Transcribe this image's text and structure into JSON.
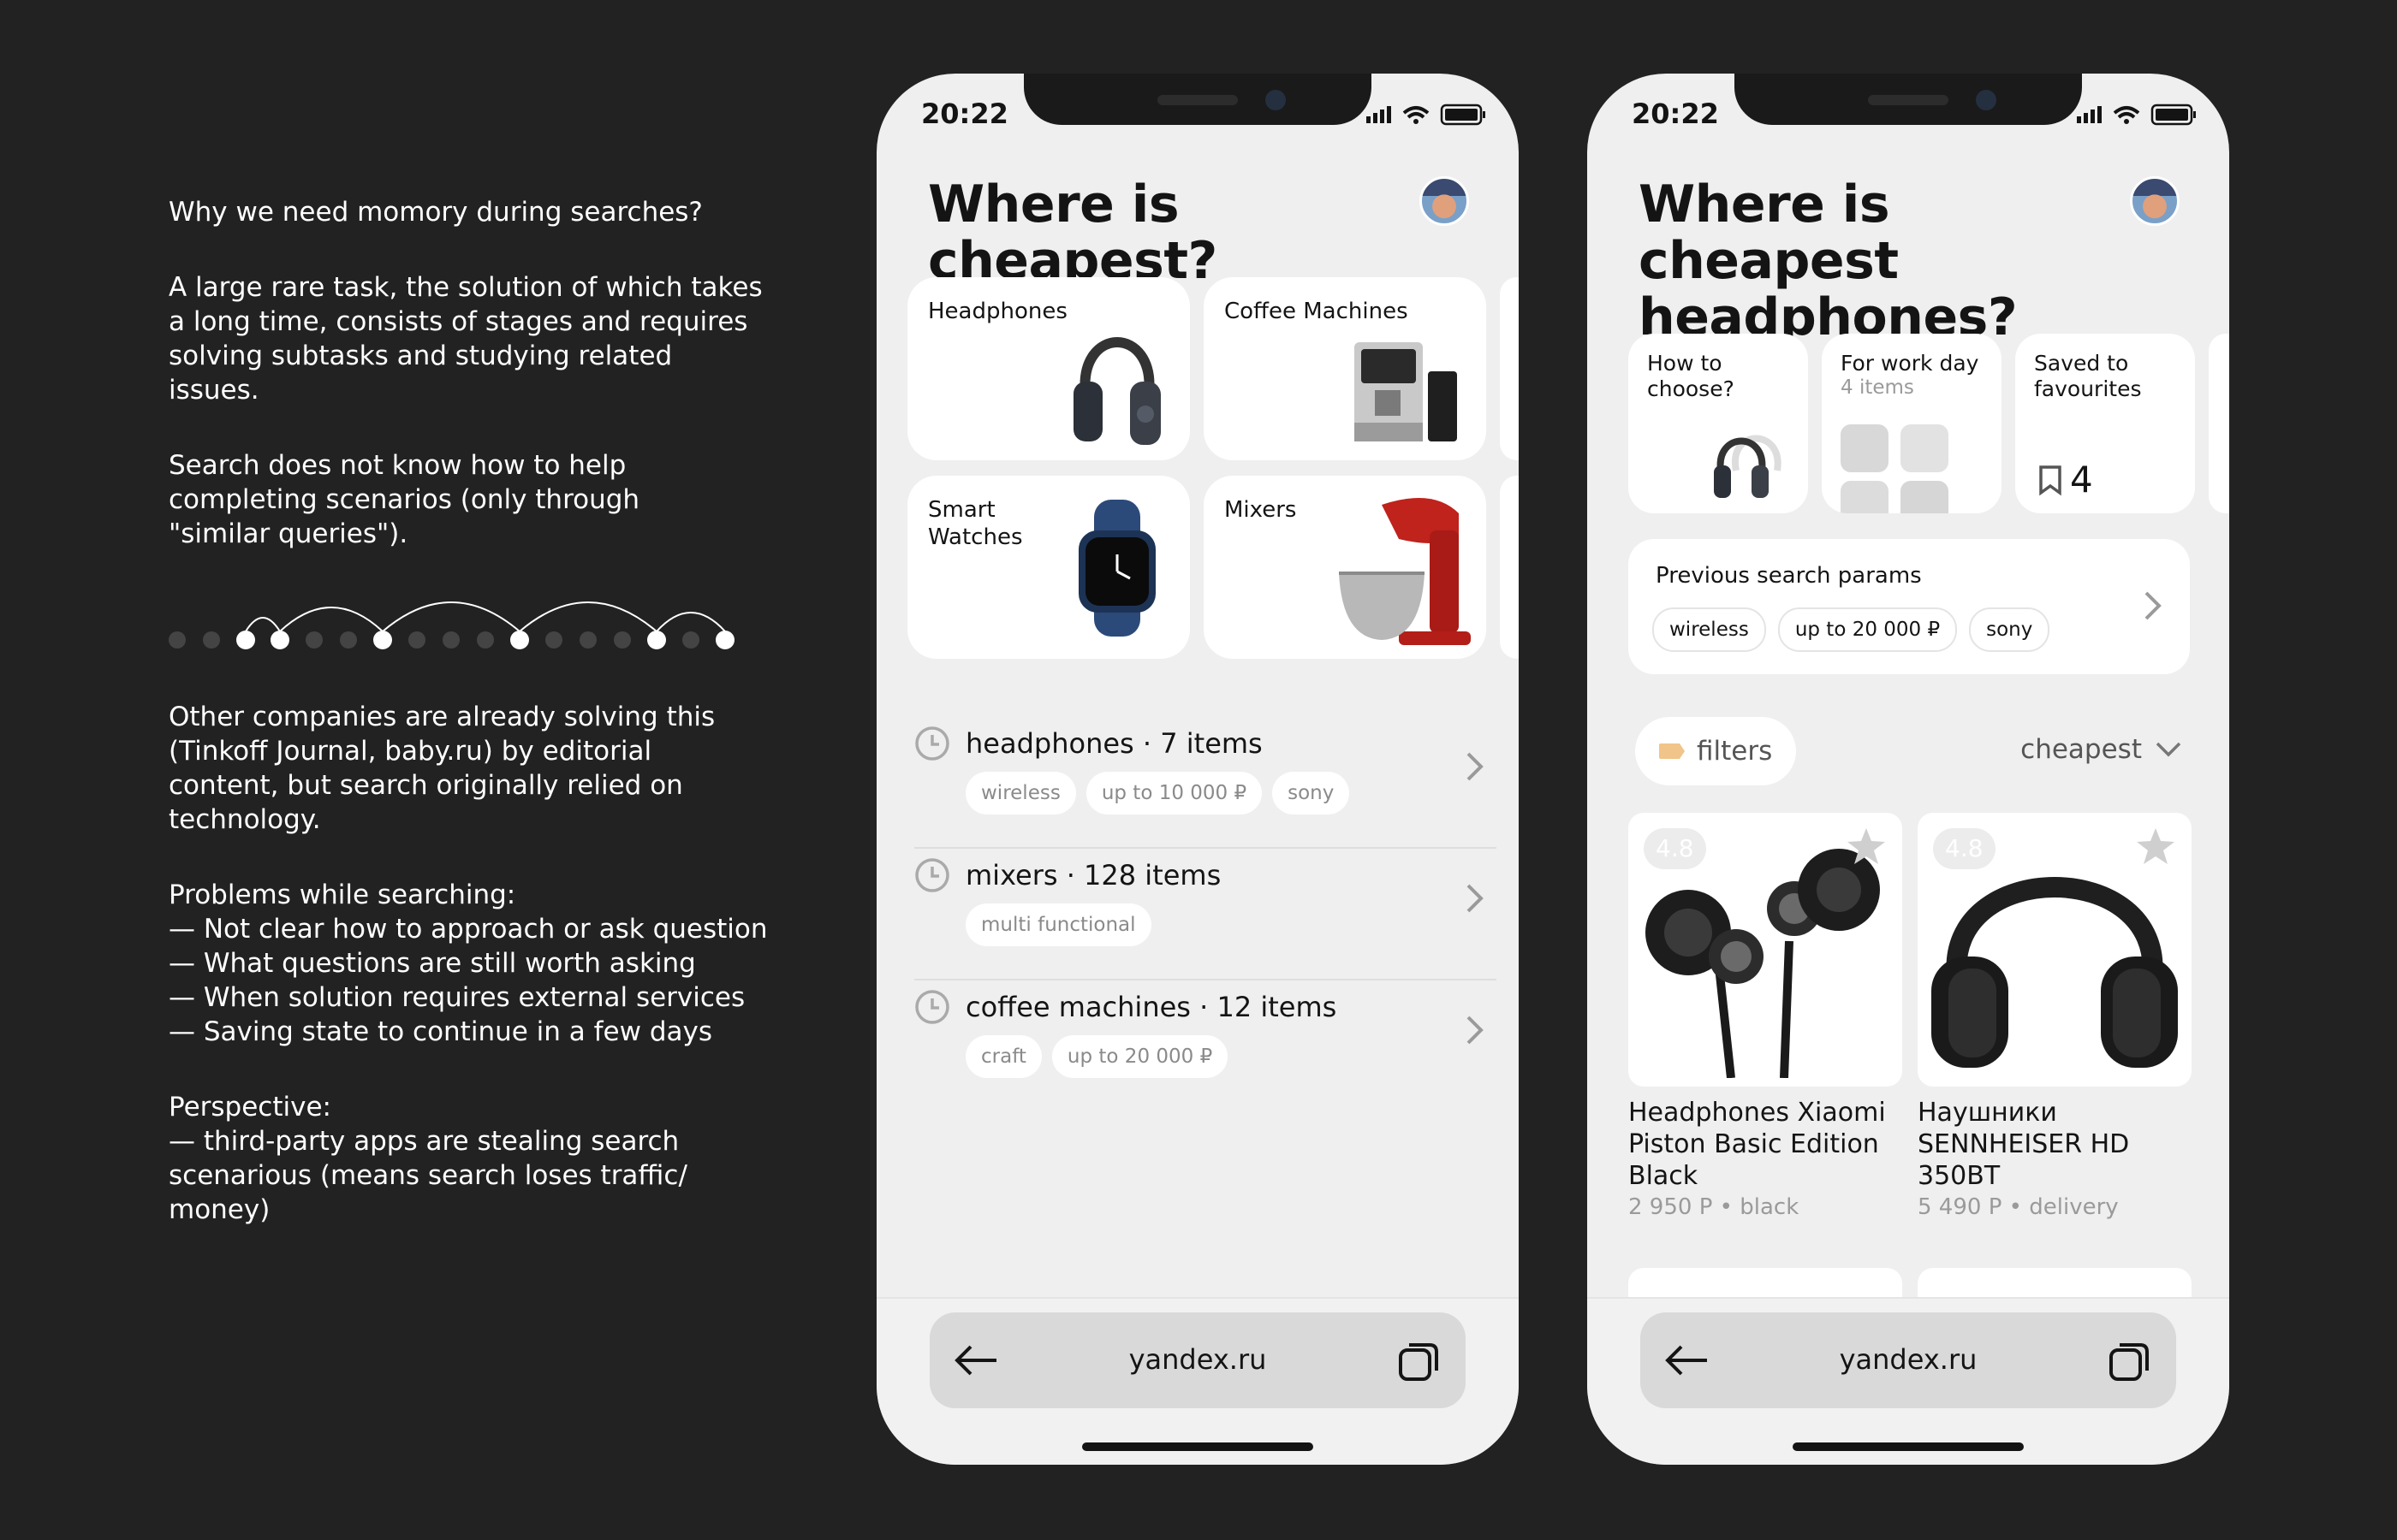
{
  "notes": {
    "p1": "Why we need momory during searches?",
    "p2": "A large rare task, the solution of which takes\na long time, consists of stages and requires\nsolving subtasks and studying related\nissues.",
    "p3": "Search does not know how to help\ncompleting scenarios (only through\n\"similar queries\").",
    "p4": "Other companies are already solving this\n(Tinkoff Journal, baby.ru) by editorial\ncontent, but search originally relied on\ntechnology.",
    "p5": "Problems while searching:\n— Not clear how to approach or ask question\n— What questions are still worth asking\n— When solution requires external services\n— Saving state to continue in a few days",
    "p6": "Perspective:\n— third-party apps are stealing search\nscenarious (means search loses traffic/\nmoney)"
  },
  "timeline": {
    "dots": 17,
    "active": [
      2,
      3,
      6,
      10,
      14,
      16
    ],
    "arcs": [
      [
        2,
        3
      ],
      [
        3,
        6
      ],
      [
        6,
        10
      ],
      [
        10,
        14
      ],
      [
        14,
        16
      ]
    ]
  },
  "phone1": {
    "time": "20:22",
    "title": "Where is cheapest?",
    "categories": [
      "Headphones",
      "Coffee Machines",
      "Smart\nWatches",
      "Mixers"
    ],
    "history": [
      {
        "query": "headphones · 7 items",
        "chips": [
          "wireless",
          "up to 10 000 ₽",
          "sony"
        ]
      },
      {
        "query": "mixers · 128 items",
        "chips": [
          "multi functional"
        ]
      },
      {
        "query": "coffee machines · 12 items",
        "chips": [
          "craft",
          "up to 20 000 ₽"
        ]
      }
    ],
    "url": "yandex.ru"
  },
  "phone2": {
    "time": "20:22",
    "title": "Where is cheapest headphones?",
    "cards": {
      "how": "How to\nchoose?",
      "work": "For work day",
      "work_sub": "4 items",
      "saved": "Saved to\nfavourites",
      "saved_count": "4"
    },
    "prev": {
      "label": "Previous search params",
      "chips": [
        "wireless",
        "up to 20 000 ₽",
        "sony"
      ]
    },
    "filters": "filters",
    "sort": "cheapest",
    "products": [
      {
        "rating": "4.8",
        "name": "Headphones Xiaomi Piston Basic Edition Black",
        "price": "2 950 Р • black"
      },
      {
        "rating": "4.8",
        "name": "Наушники SENNHEISER HD 350BT",
        "price": "5 490 Р • delivery"
      }
    ],
    "url": "yandex.ru"
  },
  "colors": {
    "bg": "#222222",
    "screen": "#efefef",
    "card": "#ffffff",
    "muted": "#8a8a8a"
  }
}
